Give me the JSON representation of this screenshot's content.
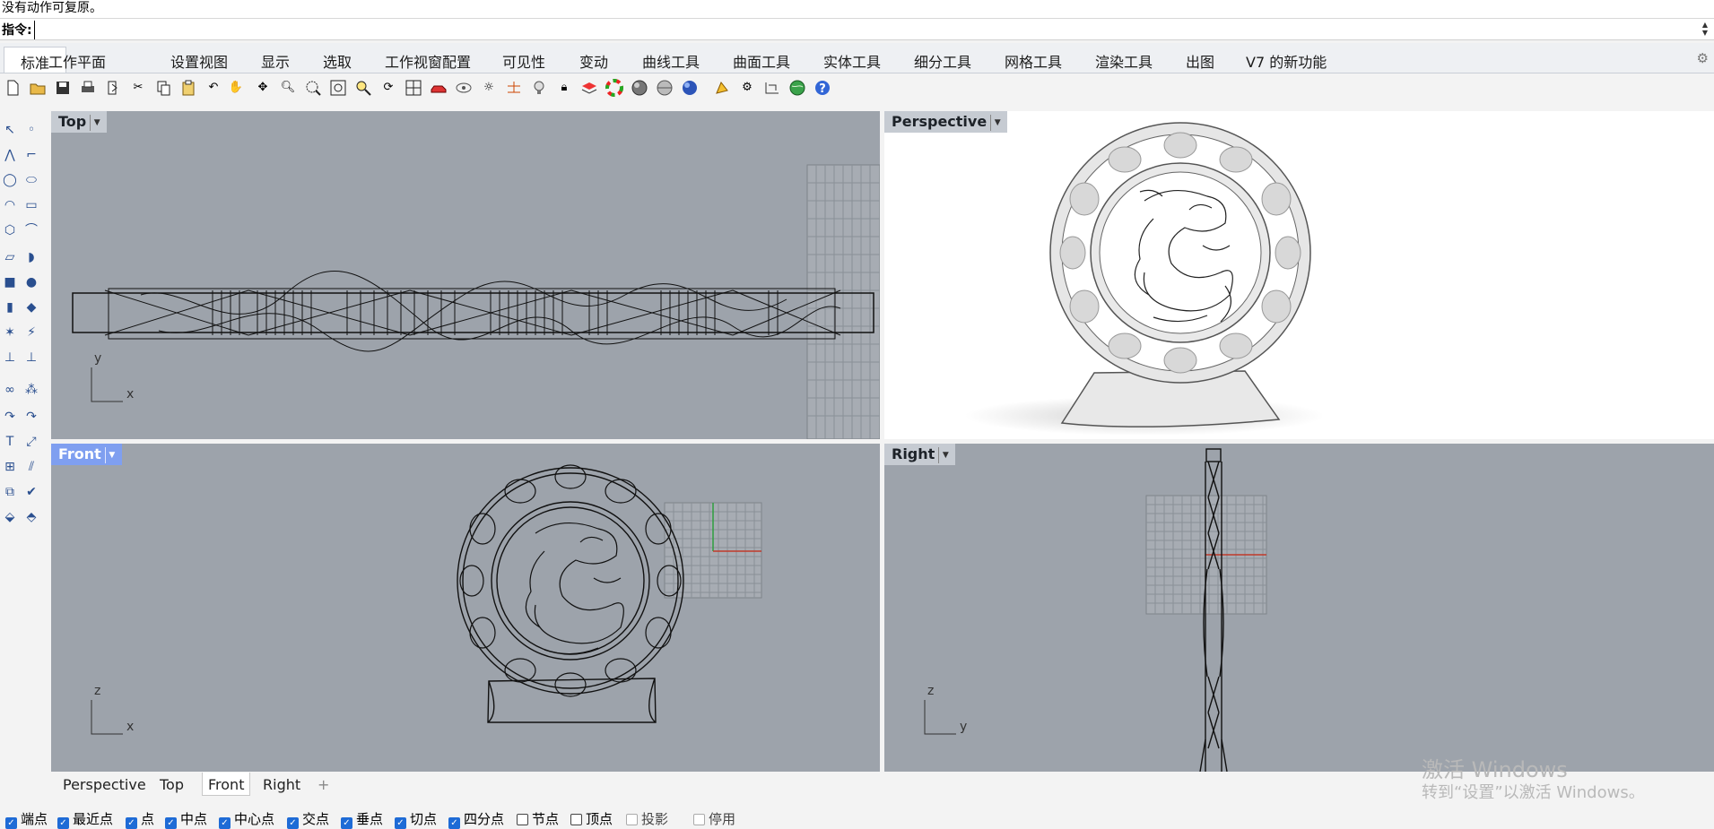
{
  "history": {
    "text": "没有动作可复原。"
  },
  "command": {
    "label": "指令:",
    "value": ""
  },
  "tabs": [
    {
      "label": "标准",
      "active": true
    },
    {
      "label": "工作平面"
    },
    {
      "label": "设置视图"
    },
    {
      "label": "显示"
    },
    {
      "label": "选取"
    },
    {
      "label": "工作视窗配置"
    },
    {
      "label": "可见性"
    },
    {
      "label": "变动"
    },
    {
      "label": "曲线工具"
    },
    {
      "label": "曲面工具"
    },
    {
      "label": "实体工具"
    },
    {
      "label": "细分工具"
    },
    {
      "label": "网格工具"
    },
    {
      "label": "渲染工具"
    },
    {
      "label": "出图"
    },
    {
      "label": "V7 的新功能"
    }
  ],
  "toolbar_icons": [
    "new-file-icon",
    "open-folder-icon",
    "save-icon",
    "print-icon",
    "import-icon",
    "cut-icon",
    "copy-icon",
    "paste-icon",
    "undo-icon",
    "pan-hand-icon",
    "rotate-view-icon",
    "zoom-icon",
    "zoom-window-icon",
    "zoom-extents-icon",
    "zoom-selected-icon",
    "rotate-camera-icon",
    "viewport-grid-icon",
    "car-icon",
    "named-views-icon",
    "sun-icon",
    "cplane-icon",
    "light-bulb-icon",
    "lock-icon",
    "layer-icon",
    "color-wheel-icon",
    "sphere-shaded-icon",
    "sphere-rendered-icon",
    "sphere-blue-icon",
    "spotlight-icon",
    "gear-settings-icon",
    "dimension-icon",
    "globe-icon",
    "help-icon"
  ],
  "left_tool_icons": [
    "select-arrow-icon",
    "point-icon",
    "polyline-icon",
    "curve-control-icon",
    "circle-icon",
    "ellipse-icon",
    "arc-icon",
    "rectangle-icon",
    "polygon-icon",
    "fillet-curve-icon",
    "surface-icon",
    "loft-icon",
    "box-icon",
    "sphere-icon",
    "cylinder-icon",
    "plane-icon",
    "transform-icon",
    "extrude-icon",
    "boolean-icon",
    "point-cloud-icon",
    "join-curve-icon",
    "offset-icon",
    "text-icon",
    "dimension-tool-icon",
    "array-icon",
    "mirror-icon",
    "grid-array-icon",
    "split-icon",
    "bend-icon",
    "check-icon",
    "analyze-icon",
    "render-icon"
  ],
  "viewports": {
    "top": {
      "title": "Top",
      "axis_a": "y",
      "axis_b": "x"
    },
    "perspective": {
      "title": "Perspective"
    },
    "front": {
      "title": "Front",
      "axis_a": "z",
      "axis_b": "x",
      "active": true
    },
    "right": {
      "title": "Right",
      "axis_a": "z",
      "axis_b": "y"
    }
  },
  "viewport_tabs": [
    {
      "label": "Perspective"
    },
    {
      "label": "Top"
    },
    {
      "label": "Front",
      "active": true
    },
    {
      "label": "Right"
    }
  ],
  "viewport_tab_add": "+",
  "snaps": [
    {
      "label": "端点",
      "checked": true
    },
    {
      "label": "最近点",
      "checked": true
    },
    {
      "label": "点",
      "checked": true
    },
    {
      "label": "中点",
      "checked": true
    },
    {
      "label": "中心点",
      "checked": true
    },
    {
      "label": "交点",
      "checked": true
    },
    {
      "label": "垂点",
      "checked": true
    },
    {
      "label": "切点",
      "checked": true
    },
    {
      "label": "四分点",
      "checked": true
    },
    {
      "label": "节点",
      "checked": false
    },
    {
      "label": "顶点",
      "checked": false
    },
    {
      "label": "投影",
      "checked": false,
      "disabled": true
    },
    {
      "label": "停用",
      "checked": false,
      "disabled": true
    }
  ],
  "watermark": {
    "line1": "激活 Windows",
    "line2": "转到“设置”以激活 Windows。"
  },
  "colors": {
    "viewport_bg": "#9da3ab",
    "active_title": "#7f9ff0",
    "checkbox": "#1e6bd6",
    "axis_x": "#c0392b",
    "axis_y": "#2e9e3e"
  }
}
